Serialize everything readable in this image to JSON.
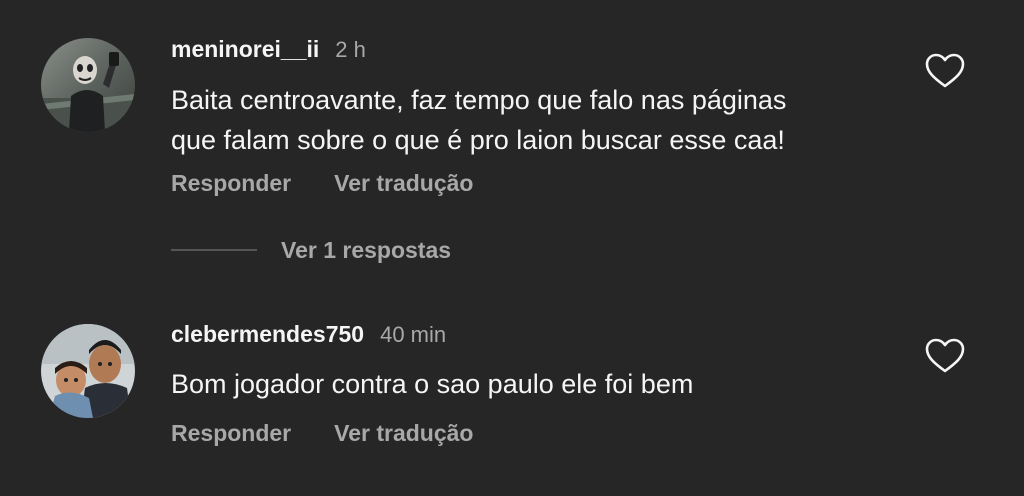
{
  "colors": {
    "background": "#262626",
    "primary_text": "#f5f5f5",
    "secondary_text": "#a8a8a8",
    "divider": "#555555"
  },
  "comments": [
    {
      "username": "meninorei__ii",
      "time": "2 h",
      "lines": [
        "Baita centroavante, faz tempo que falo nas páginas",
        "que falam sobre o que é pro laion buscar esse caa!"
      ],
      "reply_label": "Responder",
      "translate_label": "Ver tradução",
      "like_icon": "heart-outline-icon"
    },
    {
      "username": "clebermendes750",
      "time": "40 min",
      "lines": [
        "Bom jogador contra o sao paulo ele foi bem"
      ],
      "reply_label": "Responder",
      "translate_label": "Ver tradução",
      "like_icon": "heart-outline-icon"
    }
  ],
  "view_replies_label": "Ver 1 respostas"
}
